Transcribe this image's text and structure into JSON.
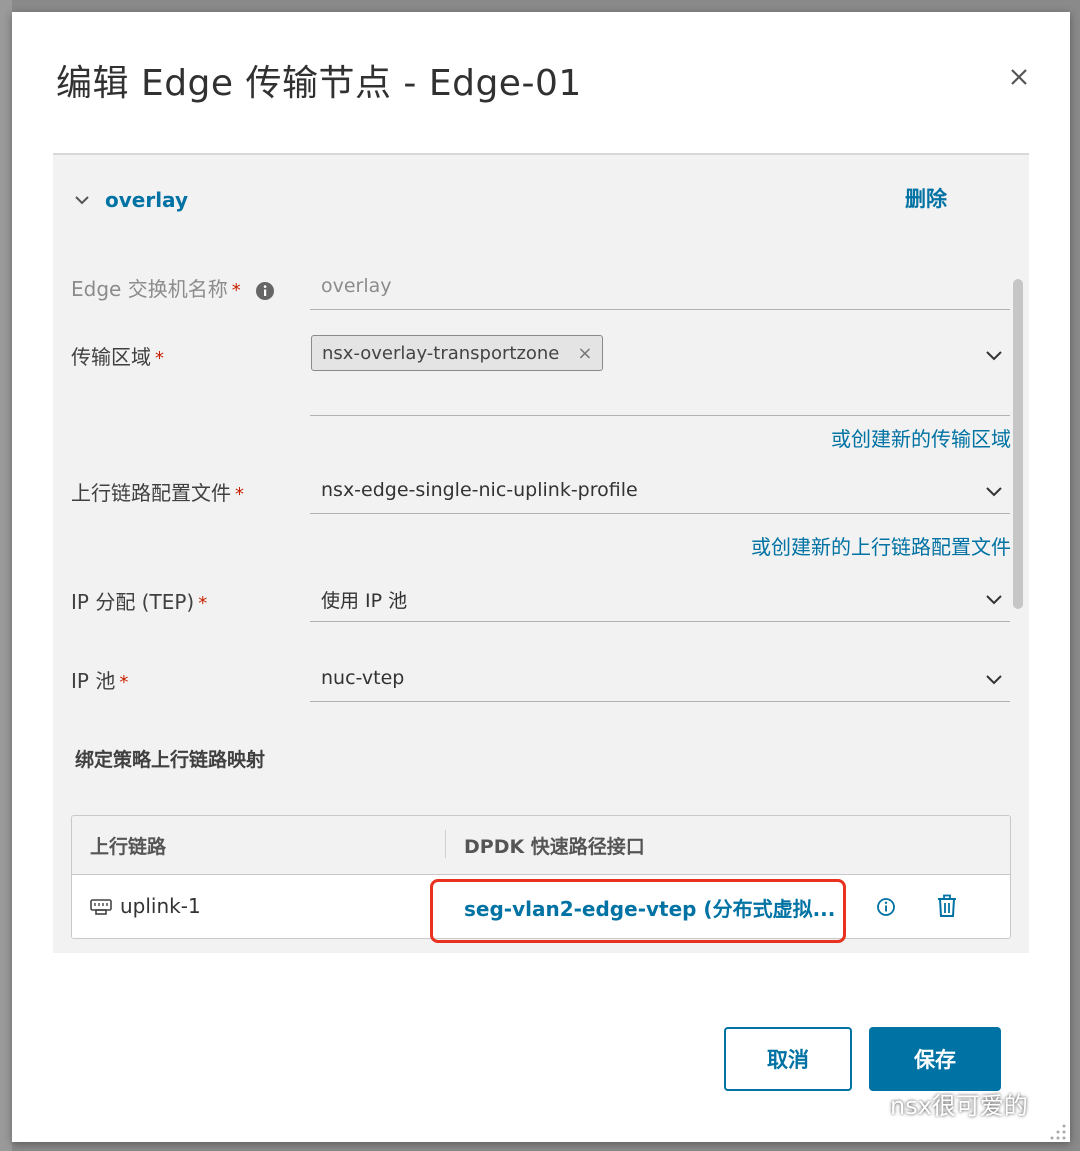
{
  "dialog": {
    "title": "编辑 Edge 传输节点 - Edge-01"
  },
  "section": {
    "name": "overlay",
    "delete_label": "删除"
  },
  "form": {
    "switch_name": {
      "label": "Edge 交换机名称",
      "value": "overlay"
    },
    "transport_zone": {
      "label": "传输区域",
      "chip": "nsx-overlay-transportzone",
      "create_link": "或创建新的传输区域"
    },
    "uplink_profile": {
      "label": "上行链路配置文件",
      "value": "nsx-edge-single-nic-uplink-profile",
      "create_link": "或创建新的上行链路配置文件"
    },
    "ip_assignment": {
      "label": "IP 分配 (TEP)",
      "value": "使用 IP 池"
    },
    "ip_pool": {
      "label": "IP 池",
      "value": "nuc-vtep"
    },
    "required_mark": "*"
  },
  "mapping": {
    "title": "绑定策略上行链路映射",
    "columns": [
      "上行链路",
      "DPDK 快速路径接口"
    ],
    "rows": [
      {
        "uplink": "uplink-1",
        "interface": "seg-vlan2-edge-vtep (分布式虚拟..."
      }
    ]
  },
  "buttons": {
    "cancel": "取消",
    "save": "保存"
  },
  "watermark": "nsx很可爱的",
  "colors": {
    "accent": "#0072a3",
    "required": "#c92100",
    "highlight": "#e8321f"
  }
}
